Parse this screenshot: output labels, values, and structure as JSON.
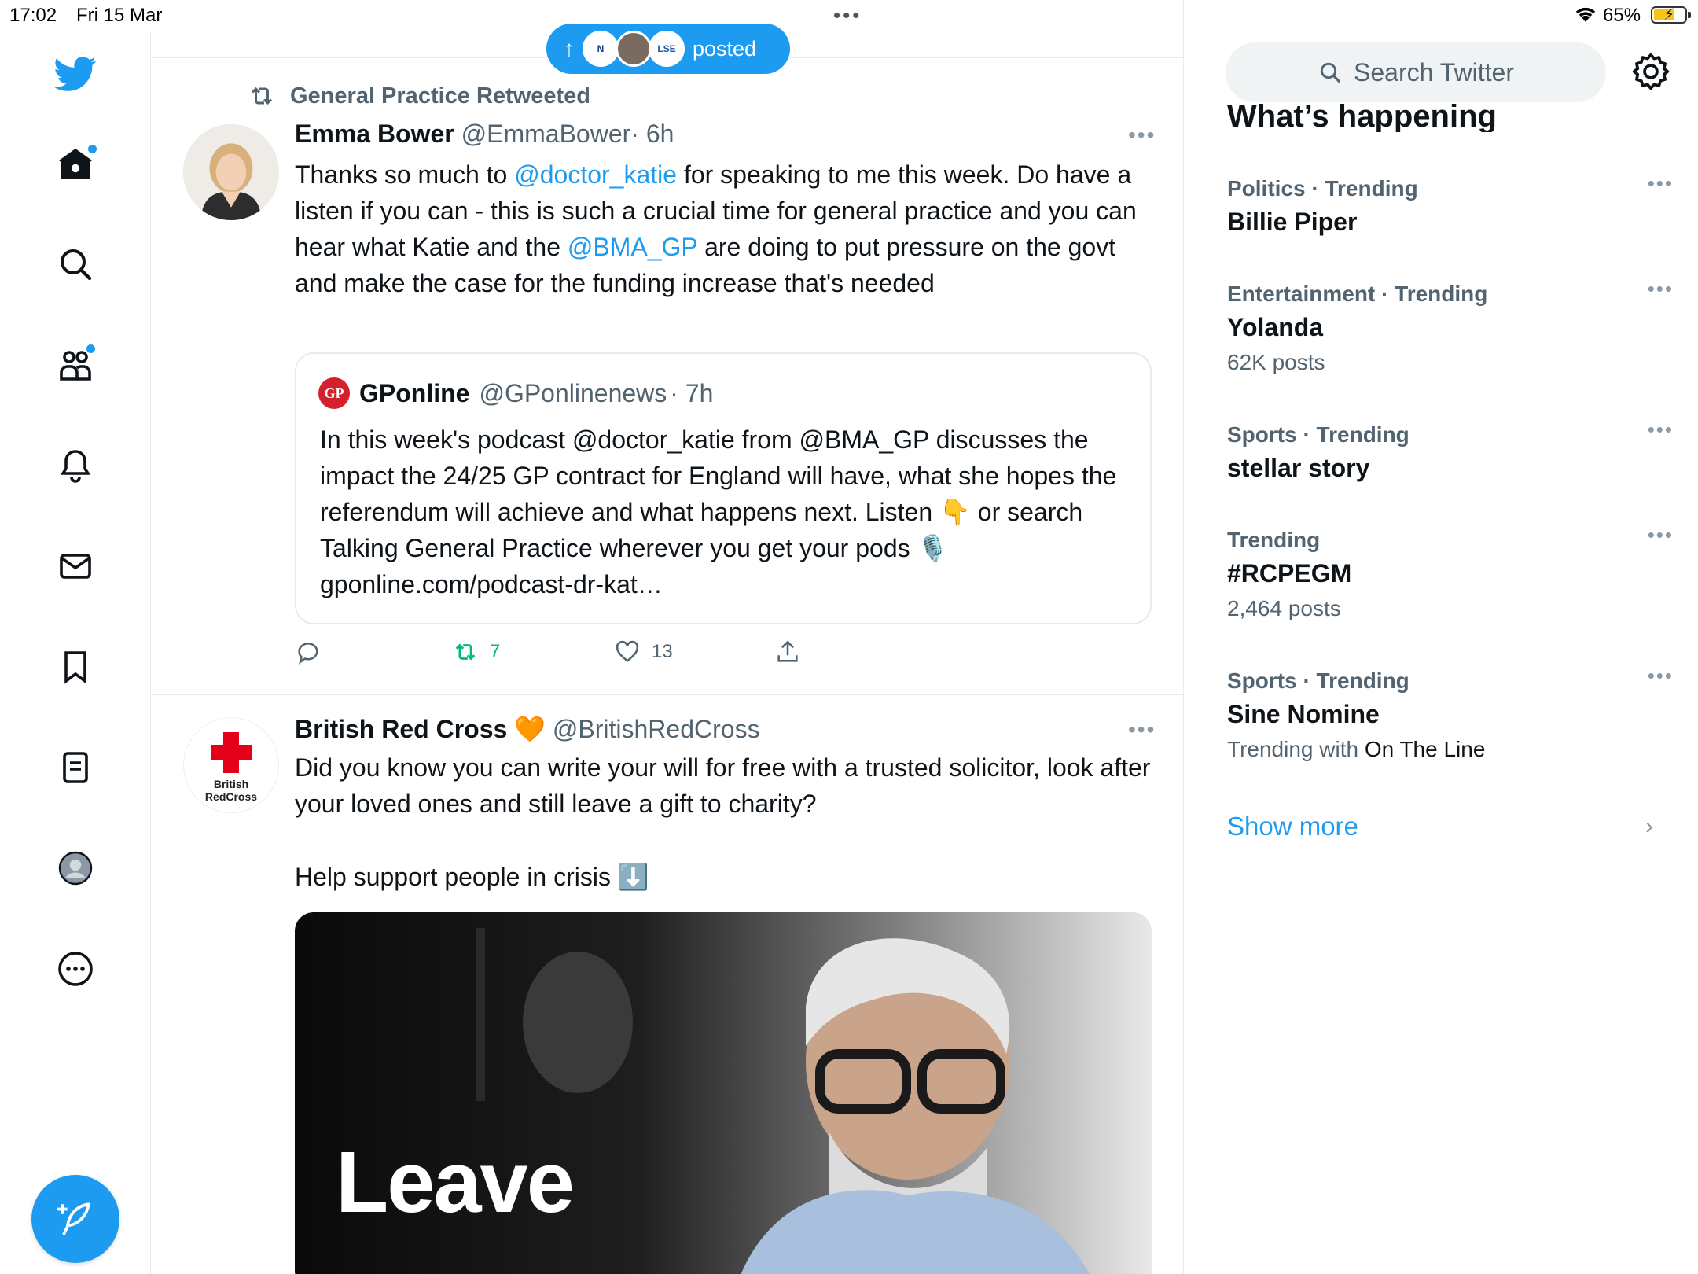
{
  "status_bar": {
    "time": "17:02",
    "date": "Fri 15 Mar",
    "battery": "65%",
    "battery_level": 0.65
  },
  "posted_pill": {
    "label": "posted"
  },
  "tweet1": {
    "retweeted_by": "General Practice Retweeted",
    "name": "Emma Bower",
    "handle": "@EmmaBower",
    "time": "· 6h",
    "text": [
      {
        "t": "Thanks so much to "
      },
      {
        "t": "@doctor_katie",
        "link": true
      },
      {
        "t": " for speaking to me this week. Do have a listen if you can - this is such a crucial time for general practice and you can hear what Katie and the "
      },
      {
        "t": "@BMA_GP",
        "link": true
      },
      {
        "t": " are doing to put pressure on the govt and make the case for the funding increase that's needed"
      }
    ],
    "quote": {
      "logo": "GP",
      "name": "GPonline",
      "handle": "@GPonlinenews",
      "time": "· 7h",
      "text": "In this week's podcast @doctor_katie from @BMA_GP discusses the impact the 24/25 GP contract for England will have, what she hopes the referendum will achieve and what happens next. Listen 👇 or search Talking General Practice wherever you get your pods 🎙️gponline.com/podcast-dr-kat…"
    },
    "retweets": "7",
    "likes": "13"
  },
  "tweet2": {
    "name": "British Red Cross",
    "emoji": "🧡",
    "handle": "@BritishRedCross",
    "avatar_text_1": "British",
    "avatar_text_2": "RedCross",
    "text_1": "Did you know you can write your will for free with a trusted solicitor, look after your loved ones and still leave a gift to charity?",
    "text_2": "Help support people in crisis ⬇️",
    "image_text": "Leave"
  },
  "search": {
    "placeholder": "Search Twitter"
  },
  "trends_title": "What’s happening",
  "trends": [
    {
      "category": "Politics · Trending",
      "title": "Billie Piper",
      "meta": ""
    },
    {
      "category": "Entertainment · Trending",
      "title": "Yolanda",
      "meta": "62K posts"
    },
    {
      "category": "Sports · Trending",
      "title": "stellar story",
      "meta": ""
    },
    {
      "category": "Trending",
      "title": "#RCPEGM",
      "meta": "2,464 posts"
    },
    {
      "category": "Sports · Trending",
      "title": "Sine Nomine",
      "meta_prefix": "Trending with ",
      "meta_strong": "On The Line"
    }
  ],
  "show_more": "Show more"
}
